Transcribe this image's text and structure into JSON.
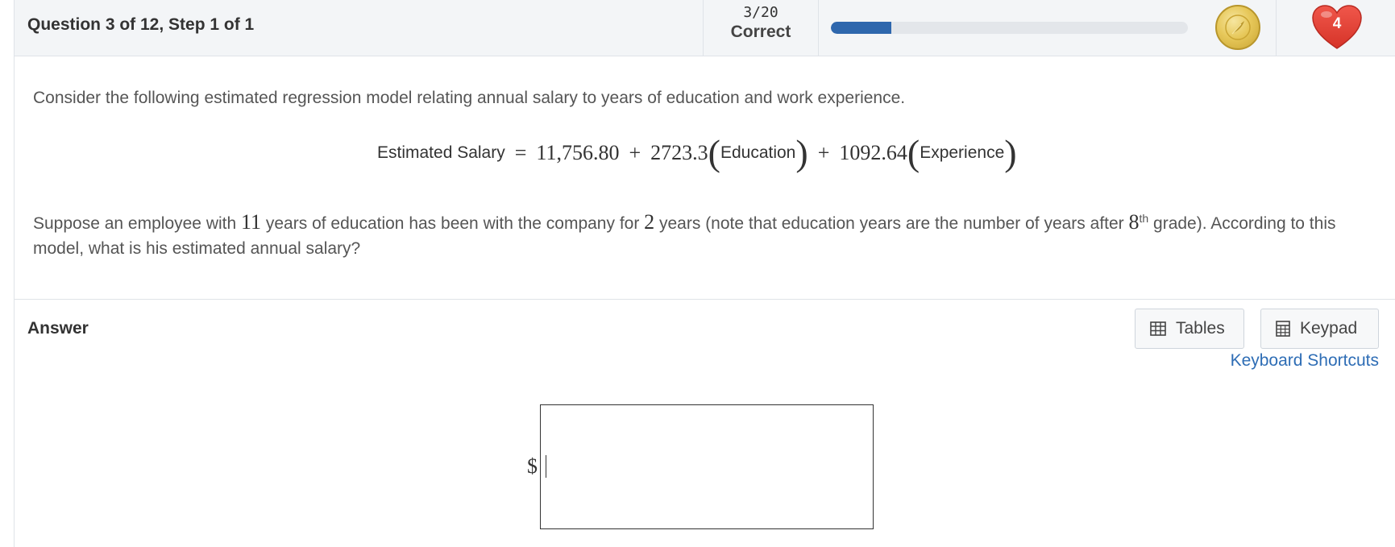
{
  "header": {
    "question_title": "Question 3 of 12, Step 1 of 1",
    "score_fraction": "3/20",
    "score_status": "Correct",
    "progress_fraction": 0.17,
    "lives_count": "4",
    "coin_icon": "coin-icon",
    "heart_icon": "heart-icon"
  },
  "question": {
    "intro": "Consider the following estimated regression model relating annual salary to years of education and work experience.",
    "equation": {
      "lhs": "Estimated Salary",
      "equals": "=",
      "intercept": "11,756.80",
      "plus1": "+",
      "coef_education": "2723.3",
      "var_education": "Education",
      "plus2": "+",
      "coef_experience": "1092.64",
      "var_experience": "Experience"
    },
    "body_part1": "Suppose an employee with ",
    "education_years": "11",
    "body_part2": " years of education has been with the company for ",
    "experience_years": "2",
    "body_part3": " years (note that education years are the number of years after ",
    "grade": "8",
    "grade_suffix": "th",
    "body_part4": " grade). According to this model, what is his estimated annual salary?"
  },
  "answer": {
    "title": "Answer",
    "tables_label": "Tables",
    "keypad_label": "Keypad",
    "shortcuts_label": "Keyboard Shortcuts",
    "currency_prefix": "$",
    "input_value": ""
  },
  "colors": {
    "accent": "#2e67ad",
    "link": "#2e6db5",
    "heart": "#e8423a",
    "coin": "#e7c85a"
  }
}
